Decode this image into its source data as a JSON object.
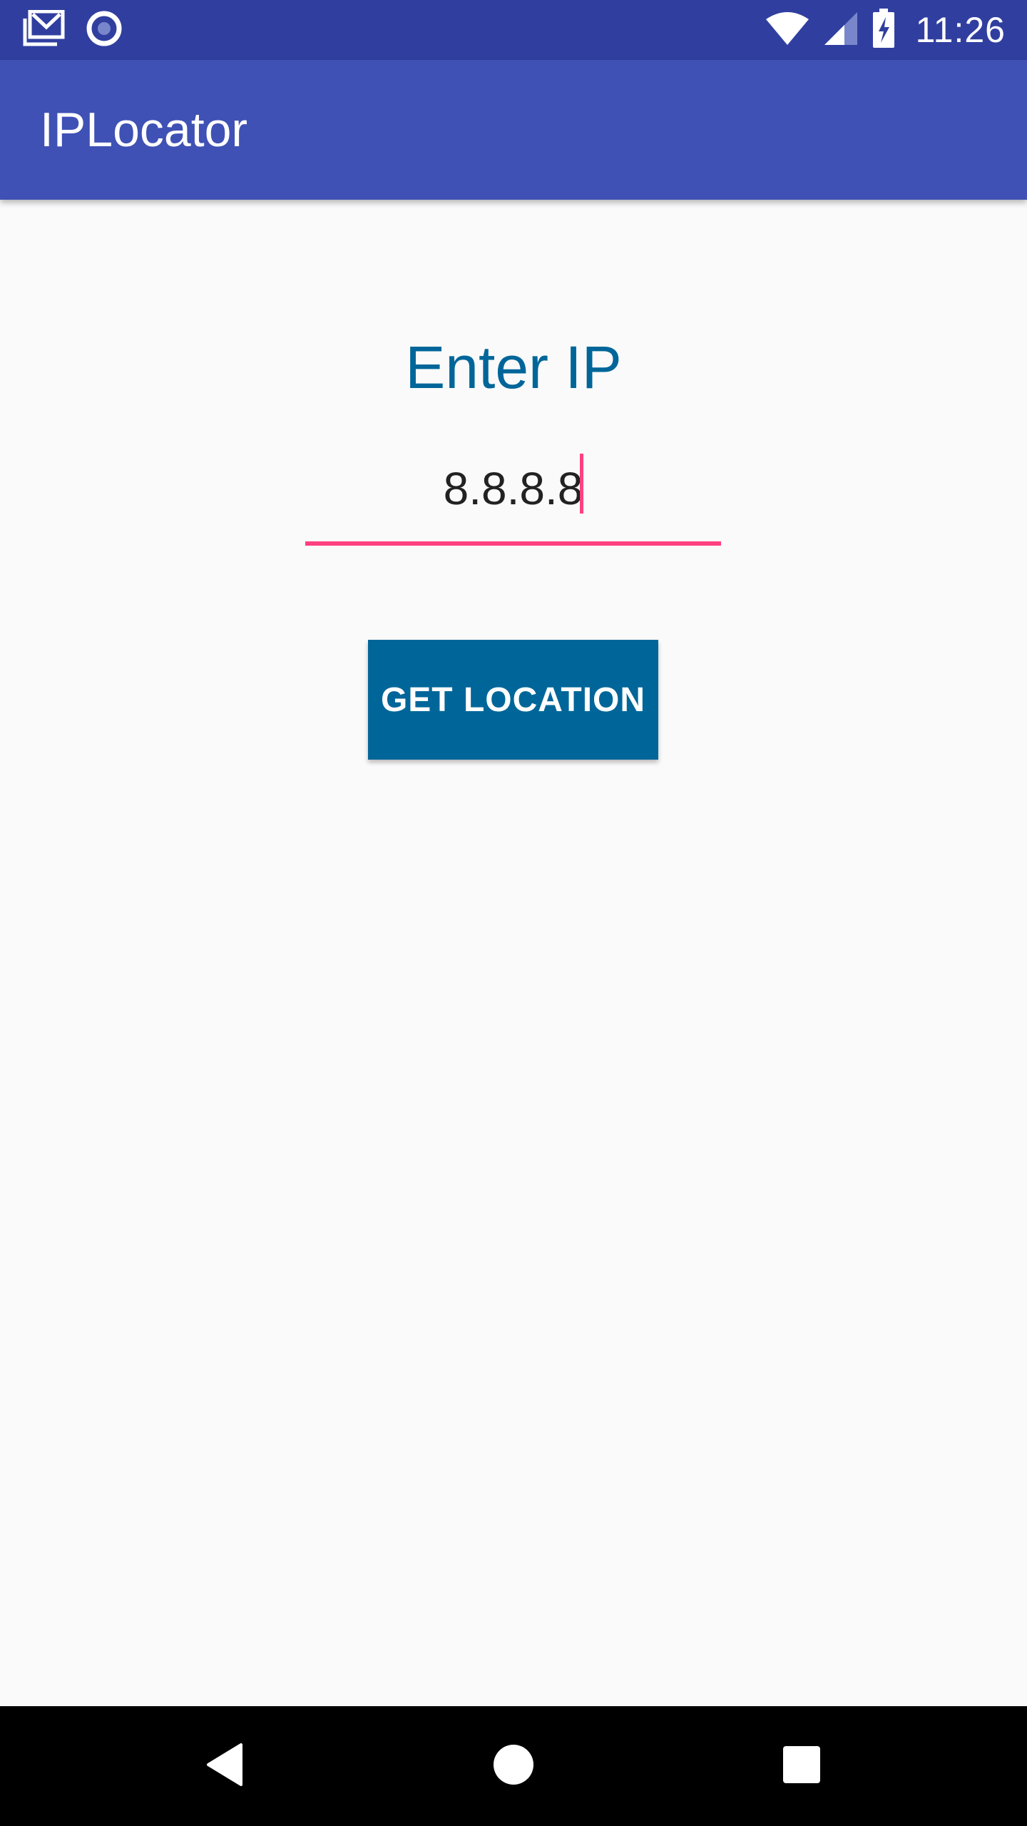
{
  "status_bar": {
    "time": "11:26",
    "left_icons": [
      "gmail-icon",
      "radio-circle-icon"
    ],
    "right_icons": [
      "wifi-icon",
      "cell-signal-icon",
      "battery-charging-icon"
    ],
    "background": "#303f9f"
  },
  "app_bar": {
    "title": "IPLocator",
    "background": "#3f51b5"
  },
  "main": {
    "prompt_label": "Enter IP",
    "ip_input": {
      "value": "8.8.8.8",
      "placeholder": ""
    },
    "get_location_label": "GET LOCATION",
    "accent_color": "#ff4081",
    "primary_color": "#006699"
  },
  "nav_bar": {
    "icons": [
      "back-icon",
      "home-icon",
      "recents-icon"
    ]
  }
}
